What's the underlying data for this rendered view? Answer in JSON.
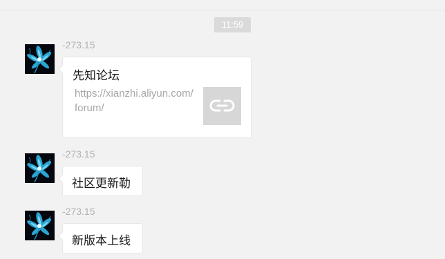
{
  "timestamp": "11:59",
  "messages": [
    {
      "sender": "-273.15",
      "type": "link",
      "title": "先知论坛",
      "url": "https://xianzhi.aliyun.com/forum/",
      "thumbnail_icon": "link-icon"
    },
    {
      "sender": "-273.15",
      "type": "text",
      "text": "社区更新勒"
    },
    {
      "sender": "-273.15",
      "type": "text",
      "text": "新版本上线"
    }
  ],
  "avatar_icon": "blue-flower-avatar",
  "colors": {
    "background": "#f2f2f2",
    "bubble": "#ffffff",
    "timestamp_bg": "#dadada",
    "sender_text": "#b1b1b1",
    "link_thumb": "#d7d7d7"
  }
}
